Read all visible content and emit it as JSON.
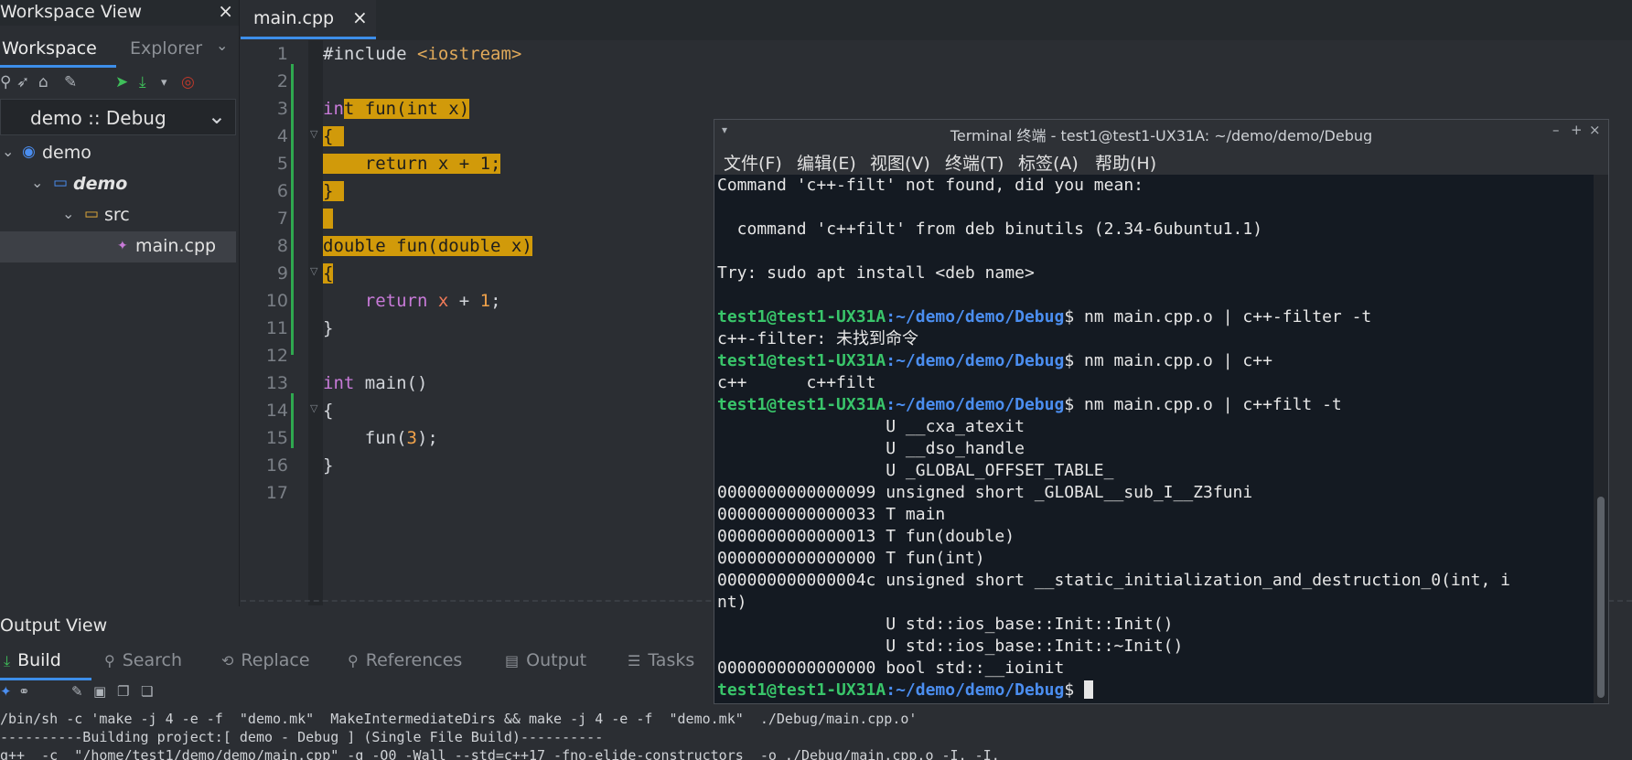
{
  "workspace": {
    "title": "Workspace View",
    "close": "×",
    "tabs": [
      {
        "label": "Workspace"
      },
      {
        "label": "Explorer"
      }
    ],
    "project_config": "demo :: Debug",
    "tree": [
      {
        "label": "demo"
      },
      {
        "label": "demo"
      },
      {
        "label": "src"
      },
      {
        "label": "main.cpp"
      }
    ]
  },
  "editor": {
    "tab_label": "main.cpp",
    "tab_close": "×",
    "line_numbers": [
      "1",
      "2",
      "3",
      "4",
      "5",
      "6",
      "7",
      "8",
      "9",
      "10",
      "11",
      "12",
      "13",
      "14",
      "15",
      "16",
      "17"
    ]
  },
  "output": {
    "title": "Output View",
    "tabs": [
      {
        "label": "Build"
      },
      {
        "label": "Search"
      },
      {
        "label": "Replace"
      },
      {
        "label": "References"
      },
      {
        "label": "Output"
      },
      {
        "label": "Tasks"
      }
    ],
    "lines": [
      "/bin/sh -c 'make -j 4 -e -f  \"demo.mk\"  MakeIntermediateDirs && make -j 4 -e -f  \"demo.mk\"  ./Debug/main.cpp.o'",
      "----------Building project:[ demo - Debug ] (Single File Build)----------",
      "g++  -c  \"/home/test1/demo/demo/main.cpp\" -g -O0 -Wall --std=c++17 -fno-elide-constructors  -o ./Debug/main.cpp.o -I. -I."
    ]
  },
  "terminal": {
    "title": "Terminal 终端 - test1@test1-UX31A: ~/demo/demo/Debug",
    "menu": [
      "文件(F)",
      "编辑(E)",
      "视图(V)",
      "终端(T)",
      "标签(A)",
      "帮助(H)"
    ],
    "user_host": "test1@test1-UX31A",
    "path": ":~/demo/demo/Debug",
    "prompt_symbol": "$",
    "lines": [
      "Command 'c++-filt' not found, did you mean:",
      "",
      "  command 'c++filt' from deb binutils (2.34-6ubuntu1.1)",
      "",
      "Try: sudo apt install <deb name>",
      "",
      "",
      "c++-filter: 未找到命令",
      "",
      "c++      c++filt",
      "",
      "                 U __cxa_atexit",
      "                 U __dso_handle",
      "                 U _GLOBAL_OFFSET_TABLE_",
      "0000000000000099 unsigned short _GLOBAL__sub_I__Z3funi",
      "0000000000000033 T main",
      "0000000000000013 T fun(double)",
      "0000000000000000 T fun(int)",
      "000000000000004c unsigned short __static_initialization_and_destruction_0(int, i",
      "nt)",
      "                 U std::ios_base::Init::Init()",
      "                 U std::ios_base::Init::~Init()",
      "0000000000000000 bool std::__ioinit"
    ],
    "commands": [
      "nm main.cpp.o | c++-filter -t",
      "nm main.cpp.o | c++",
      "nm main.cpp.o | c++filt -t",
      ""
    ]
  }
}
